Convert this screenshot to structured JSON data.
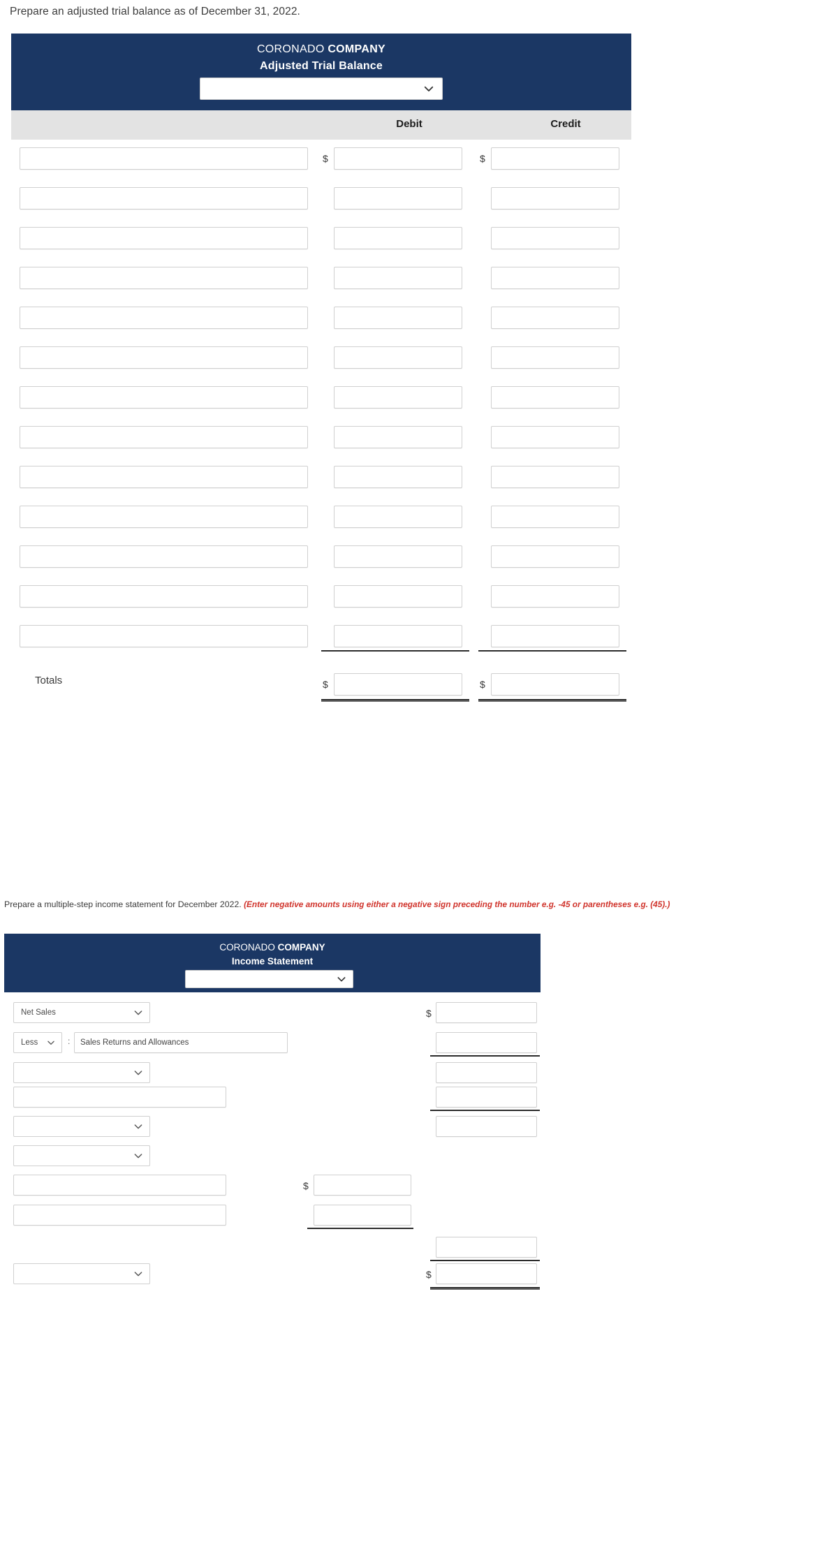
{
  "section1": {
    "prompt": "Prepare an adjusted trial balance as of December 31, 2022.",
    "statement": {
      "company_prefix": "CORONADO ",
      "company_bold": "COMPANY",
      "title": "Adjusted Trial Balance",
      "period_select_value": "",
      "period_select_placeholder": ""
    },
    "columns": {
      "account": "",
      "debit": "Debit",
      "credit": "Credit"
    },
    "rows": [
      {
        "account": "",
        "debit": "",
        "credit": "",
        "show_dollar": true
      },
      {
        "account": "",
        "debit": "",
        "credit": "",
        "show_dollar": false
      },
      {
        "account": "",
        "debit": "",
        "credit": "",
        "show_dollar": false
      },
      {
        "account": "",
        "debit": "",
        "credit": "",
        "show_dollar": false
      },
      {
        "account": "",
        "debit": "",
        "credit": "",
        "show_dollar": false
      },
      {
        "account": "",
        "debit": "",
        "credit": "",
        "show_dollar": false
      },
      {
        "account": "",
        "debit": "",
        "credit": "",
        "show_dollar": false
      },
      {
        "account": "",
        "debit": "",
        "credit": "",
        "show_dollar": false
      },
      {
        "account": "",
        "debit": "",
        "credit": "",
        "show_dollar": false
      },
      {
        "account": "",
        "debit": "",
        "credit": "",
        "show_dollar": false
      },
      {
        "account": "",
        "debit": "",
        "credit": "",
        "show_dollar": false
      },
      {
        "account": "",
        "debit": "",
        "credit": "",
        "show_dollar": false
      },
      {
        "account": "",
        "debit": "",
        "credit": "",
        "show_dollar": false
      }
    ],
    "totals": {
      "label": "Totals",
      "debit": "",
      "credit": "",
      "dollar": "$"
    },
    "dollar_sign": "$"
  },
  "section2": {
    "prompt_plain": "Prepare a multiple-step income statement for December 2022. ",
    "prompt_warning": "(Enter negative amounts using either a negative sign preceding the number e.g. -45 or parentheses e.g. (45).)",
    "statement": {
      "company_prefix": "CORONADO ",
      "company_bold": "COMPANY",
      "title": "Income Statement",
      "period_select_value": ""
    },
    "dollar_sign": "$",
    "colon": ":",
    "rows": [
      {
        "kind": "select",
        "label": "Net Sales",
        "amount_col": "b",
        "amount": "",
        "dollar": true
      },
      {
        "kind": "less",
        "less_label": "Less",
        "text": "Sales Returns and Allowances",
        "amount_col": "b",
        "amount": "",
        "dollar": false,
        "rule_after": "b"
      },
      {
        "kind": "select",
        "label": "",
        "amount_col": "b",
        "amount": "",
        "dollar": false
      },
      {
        "kind": "text",
        "label": "",
        "amount_col": "b",
        "amount": "",
        "dollar": false,
        "rule_after": "b"
      },
      {
        "kind": "select",
        "label": "",
        "amount_col": "b",
        "amount": "",
        "dollar": false
      },
      {
        "kind": "select",
        "label": "",
        "amount_col": "none",
        "amount": "",
        "dollar": false
      },
      {
        "kind": "text",
        "label": "",
        "amount_col": "a",
        "amount": "",
        "dollar": true
      },
      {
        "kind": "text",
        "label": "",
        "amount_col": "a",
        "amount": "",
        "dollar": false,
        "rule_after": "a"
      },
      {
        "kind": "blank",
        "label": "",
        "amount_col": "b",
        "amount": "",
        "dollar": false,
        "rule_after": "b"
      },
      {
        "kind": "select",
        "label": "",
        "amount_col": "b",
        "amount": "",
        "dollar": true,
        "double_rule_after": "b"
      }
    ]
  },
  "colors": {
    "header_blue": "#1b3764",
    "colhead_gray": "#e3e3e3",
    "warning_red": "#d0342c",
    "field_border": "#d0d0d0"
  }
}
